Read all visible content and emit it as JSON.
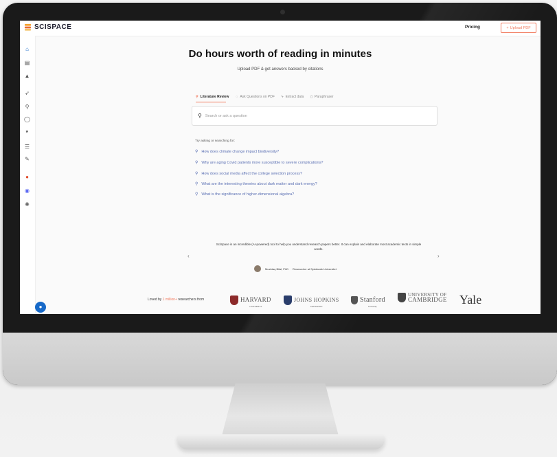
{
  "app": {
    "name": "SCISPACE"
  },
  "header": {
    "pricing_label": "Pricing",
    "upload_label": "Upload PDF"
  },
  "hero": {
    "title": "Do hours worth of reading in minutes",
    "subtitle": "Upload PDF & get answers backed by citations"
  },
  "tabs": [
    {
      "label": "Literature Review",
      "icon": "search-icon",
      "active": true
    },
    {
      "label": "Ask Questions on PDF",
      "icon": "chat-icon",
      "active": false
    },
    {
      "label": "Extract data",
      "icon": "bolt-icon",
      "active": false
    },
    {
      "label": "Paraphraser",
      "icon": "document-icon",
      "active": false
    }
  ],
  "search": {
    "placeholder": "Search or ask a question"
  },
  "suggestions": {
    "heading": "Try asking or searching for:",
    "items": [
      "How does climate change impact biodiversity?",
      "Why are aging Covid patients more susceptible to severe complications?",
      "How does social media affect the college selection process?",
      "What are the interesting theories about dark matter and dark energy?",
      "What is the significance of higher-dimensional algebra?"
    ]
  },
  "testimonial": {
    "quote": "SciSpace is an incredible (AI-powered) tool to help you understand research papers better. It can explain and elaborate most academic texts in simple words.",
    "author": "Mushtaq Bilal, PhD",
    "role": "Researcher at Syddansk Universitet"
  },
  "footer": {
    "loved_prefix": "Loved by",
    "loved_highlight": "1 million+",
    "loved_suffix": "researchers from",
    "universities": [
      "HARVARD",
      "JOHNS HOPKINS",
      "Stanford",
      "UNIVERSITY OF CAMBRIDGE",
      "Yale"
    ],
    "harvard_sub": "UNIVERSITY",
    "hopkins_sub": "UNIVERSITY",
    "stanford_sub": "University",
    "cambridge_top": "UNIVERSITY OF",
    "cambridge_bottom": "CAMBRIDGE"
  },
  "colors": {
    "accent": "#f27a5e",
    "link": "#5a6fb3",
    "primary": "#1769c8"
  }
}
